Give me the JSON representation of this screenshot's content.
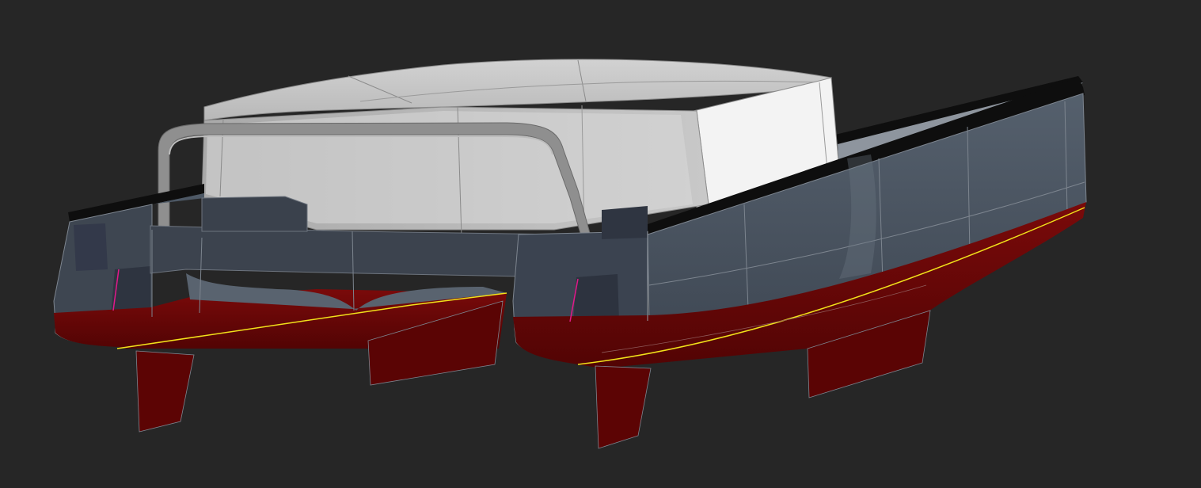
{
  "viewport": {
    "background": "#262626",
    "view": "perspective"
  },
  "model": {
    "type": "catamaran-hull-render",
    "colors": {
      "hull_topsides": "#4a5563",
      "hull_topsides_light": "#5c6875",
      "hull_topsides_dark": "#3a424d",
      "antifouling": "#6a0606",
      "antifouling_dark": "#4e0303",
      "boot_stripe": "#f2e21a",
      "deckhouse_top": "#c9c9c9",
      "deckhouse_face": "#f2f2f2",
      "glass": "#bdbdbd",
      "sheer_rail": "#101010",
      "edge_lines": "#9aa0a8",
      "marker_line": "#e2188a"
    }
  }
}
